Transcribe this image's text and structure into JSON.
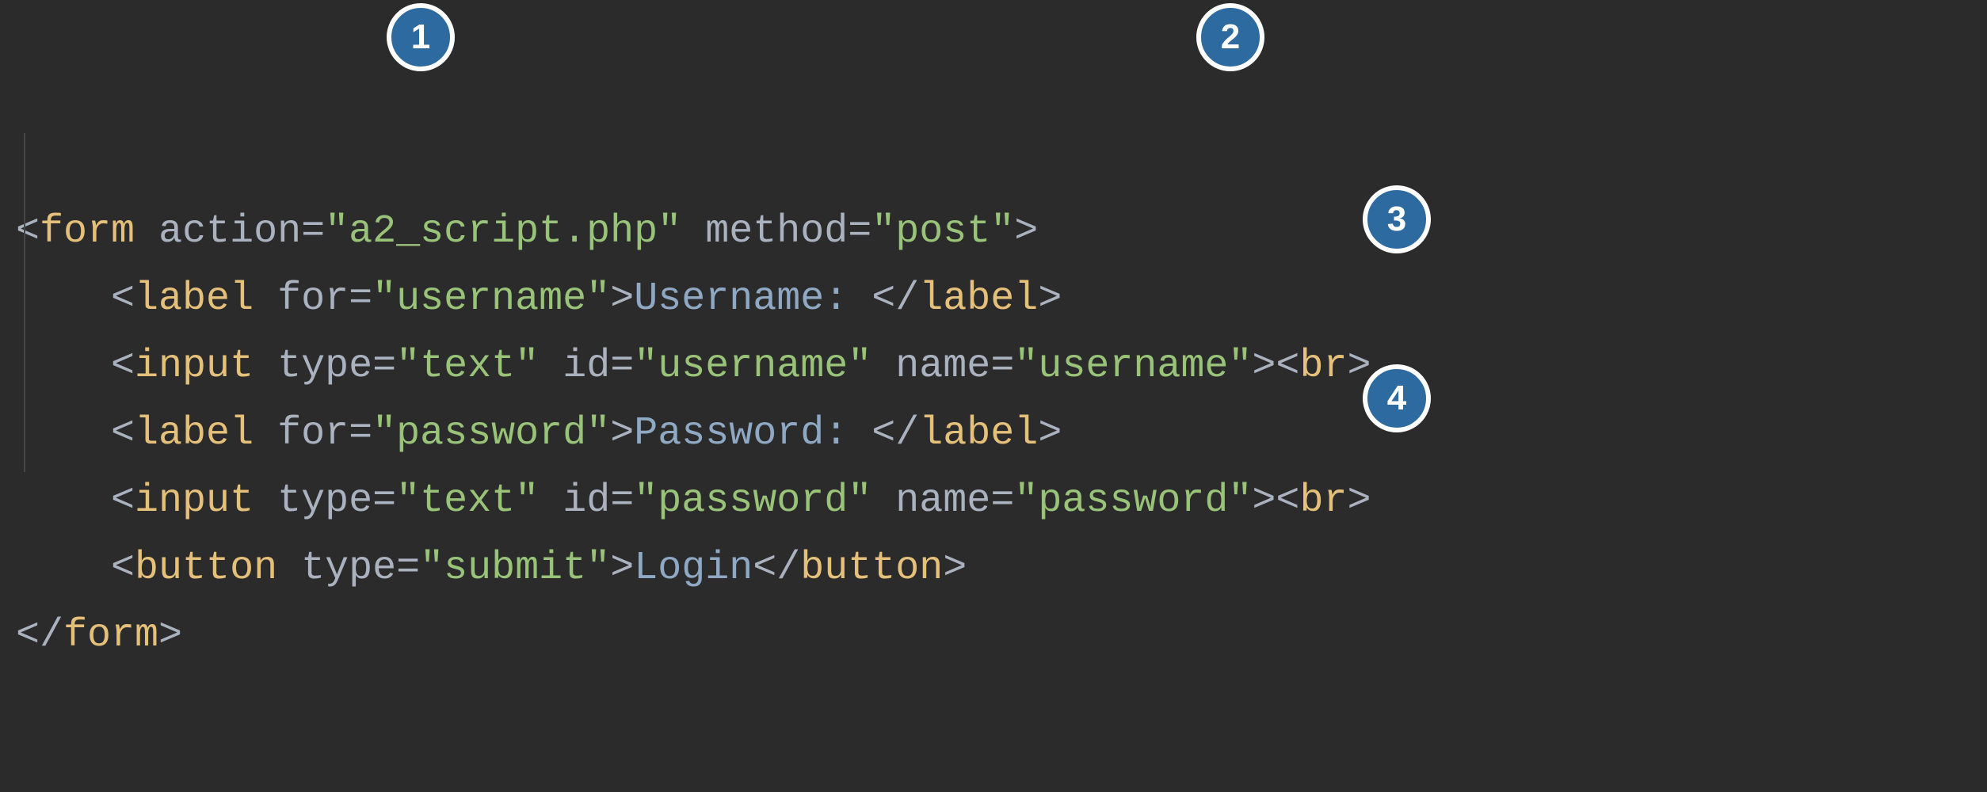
{
  "annotations": {
    "badge1": "1",
    "badge2": "2",
    "badge3": "3",
    "badge4": "4"
  },
  "code": {
    "line1": {
      "open": "<",
      "tag": "form",
      "sp1": " ",
      "attr1": "action",
      "eq1": "=",
      "val1": "\"a2_script.php\"",
      "sp2": " ",
      "attr2": "method",
      "eq2": "=",
      "val2": "\"post\"",
      "close": ">"
    },
    "line2": {
      "open": "<",
      "tag": "label",
      "sp": " ",
      "attr": "for",
      "eq": "=",
      "val": "\"username\"",
      "close1": ">",
      "text": "Username: ",
      "open2": "</",
      "tag2": "label",
      "close2": ">"
    },
    "line3": {
      "open": "<",
      "tag": "input",
      "sp1": " ",
      "attr1": "type",
      "eq1": "=",
      "val1": "\"text\"",
      "sp2": " ",
      "attr2": "id",
      "eq2": "=",
      "val2": "\"username\"",
      "sp3": " ",
      "attr3": "name",
      "eq3": "=",
      "val3": "\"username\"",
      "close": ">",
      "bropen": "<",
      "brtag": "br",
      "brclose": ">"
    },
    "line4": {
      "open": "<",
      "tag": "label",
      "sp": " ",
      "attr": "for",
      "eq": "=",
      "val": "\"password\"",
      "close1": ">",
      "text": "Password: ",
      "open2": "</",
      "tag2": "label",
      "close2": ">"
    },
    "line5": {
      "open": "<",
      "tag": "input",
      "sp1": " ",
      "attr1": "type",
      "eq1": "=",
      "val1": "\"text\"",
      "sp2": " ",
      "attr2": "id",
      "eq2": "=",
      "val2": "\"password\"",
      "sp3": " ",
      "attr3": "name",
      "eq3": "=",
      "val3": "\"password\"",
      "close": ">",
      "bropen": "<",
      "brtag": "br",
      "brclose": ">"
    },
    "line6": {
      "open": "<",
      "tag": "button",
      "sp": " ",
      "attr": "type",
      "eq": "=",
      "val": "\"submit\"",
      "close1": ">",
      "text": "Login",
      "open2": "</",
      "tag2": "button",
      "close2": ">"
    },
    "line7": {
      "open": "</",
      "tag": "form",
      "close": ">"
    }
  }
}
